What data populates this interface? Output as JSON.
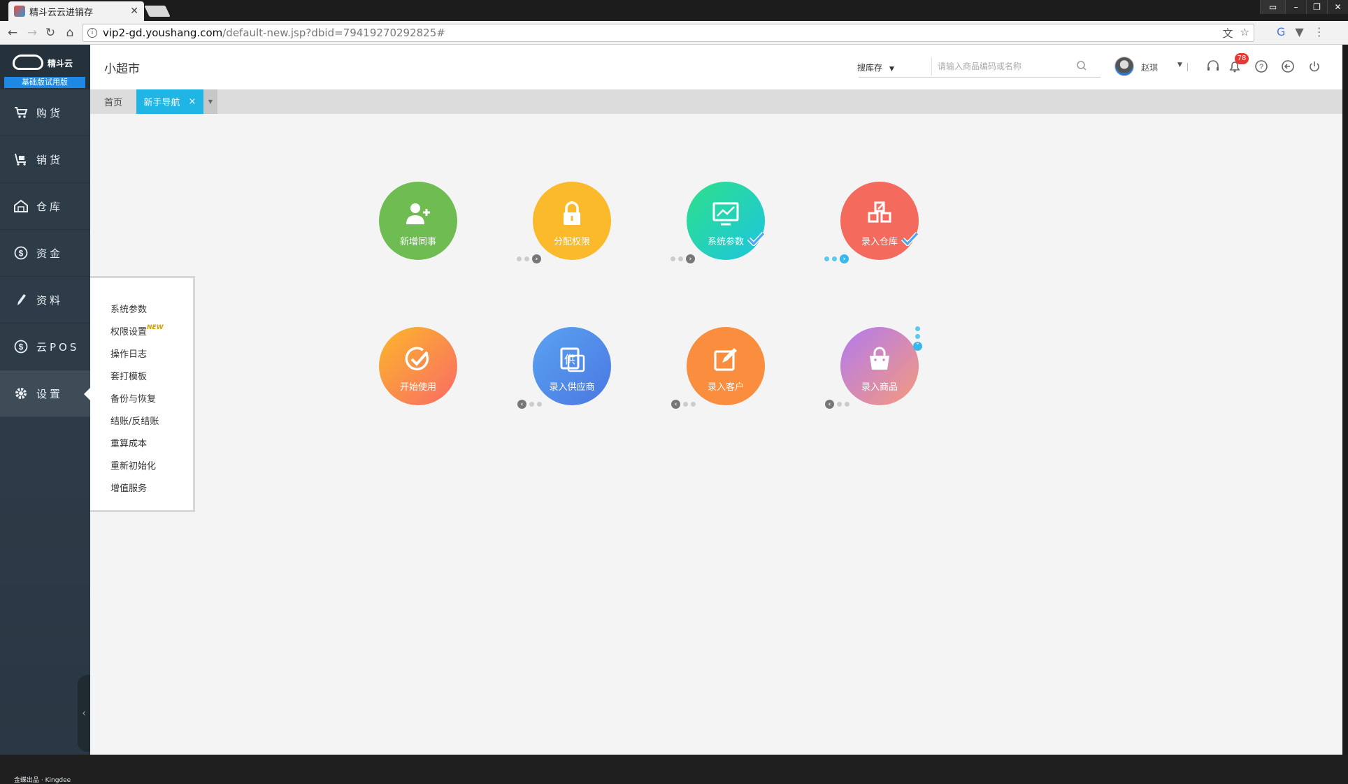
{
  "browser": {
    "tab_title": "精斗云云进销存",
    "url_host": "vip2-gd.youshang.com",
    "url_path": "/default-new.jsp?dbid=79419270292825#"
  },
  "sidebar": {
    "brand": "精斗云",
    "trial_label": "基础版试用版",
    "items": [
      {
        "label": "购货",
        "icon": "cart-icon"
      },
      {
        "label": "销货",
        "icon": "trolley-icon"
      },
      {
        "label": "仓库",
        "icon": "warehouse-icon"
      },
      {
        "label": "资金",
        "icon": "dollar-icon"
      },
      {
        "label": "资料",
        "icon": "pencil-icon"
      },
      {
        "label": "云POS",
        "icon": "dollar-icon"
      },
      {
        "label": "设置",
        "icon": "gear-icon"
      }
    ],
    "footer": "金蝶出品 · Kingdee"
  },
  "header": {
    "store_name": "小超市",
    "search_scope": "搜库存",
    "search_placeholder": "请输入商品编码或名称",
    "user_name": "赵琪",
    "notification_count": "78"
  },
  "tabs": {
    "home": "首页",
    "guide": "新手导航",
    "close": "×"
  },
  "settings_menu": {
    "items": [
      "系统参数",
      "权限设置",
      "操作日志",
      "套打模板",
      "备份与恢复",
      "结账/反结账",
      "重算成本",
      "重新初始化",
      "增值服务"
    ],
    "new_tag": "NEW"
  },
  "guide": {
    "steps": [
      {
        "label": "新增同事",
        "color": "#6ebc52",
        "done": false
      },
      {
        "label": "分配权限",
        "color": "#fbb92c",
        "done": false
      },
      {
        "label": "系统参数",
        "color": "#2ad0b0",
        "done": true
      },
      {
        "label": "录入仓库",
        "color": "#f46b5e",
        "done": true
      },
      {
        "label": "录入商品",
        "color": "#d07fd9",
        "done": false
      },
      {
        "label": "录入客户",
        "color": "#fb8d3e",
        "done": false
      },
      {
        "label": "录入供应商",
        "color": "#4f8fe8",
        "done": false
      },
      {
        "label": "开始使用",
        "color": "#fb8a48",
        "done": false
      }
    ],
    "supplier_glyph": "供"
  },
  "colors": {
    "accent": "#1fb5e5",
    "sidebar_bg": "#2f3d48",
    "badge": "#e53935"
  }
}
